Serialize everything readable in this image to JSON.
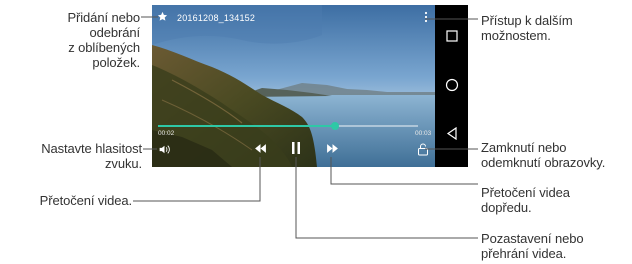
{
  "annotations": {
    "favorite": "Přidání nebo\nodebrání\nz oblíbených\npoložek.",
    "more_options": "Přístup k dalším\nmožnostem.",
    "volume": "Nastavte hlasitost\nzvuku.",
    "rewind": "Přetočení videa.",
    "lock": "Zamknutí nebo\nodemknutí obrazovky.",
    "fast_forward": "Přetočení videa\ndopředu.",
    "pause": "Pozastavení nebo\npřehrání videa."
  },
  "player": {
    "file_name": "20161208_134152",
    "current_time": "00:02",
    "total_time": "00:03",
    "progress": 0.68
  },
  "colors": {
    "progress_accent": "#2ec8a6",
    "nav_bar": "#000000",
    "annotation_text": "#333333"
  }
}
